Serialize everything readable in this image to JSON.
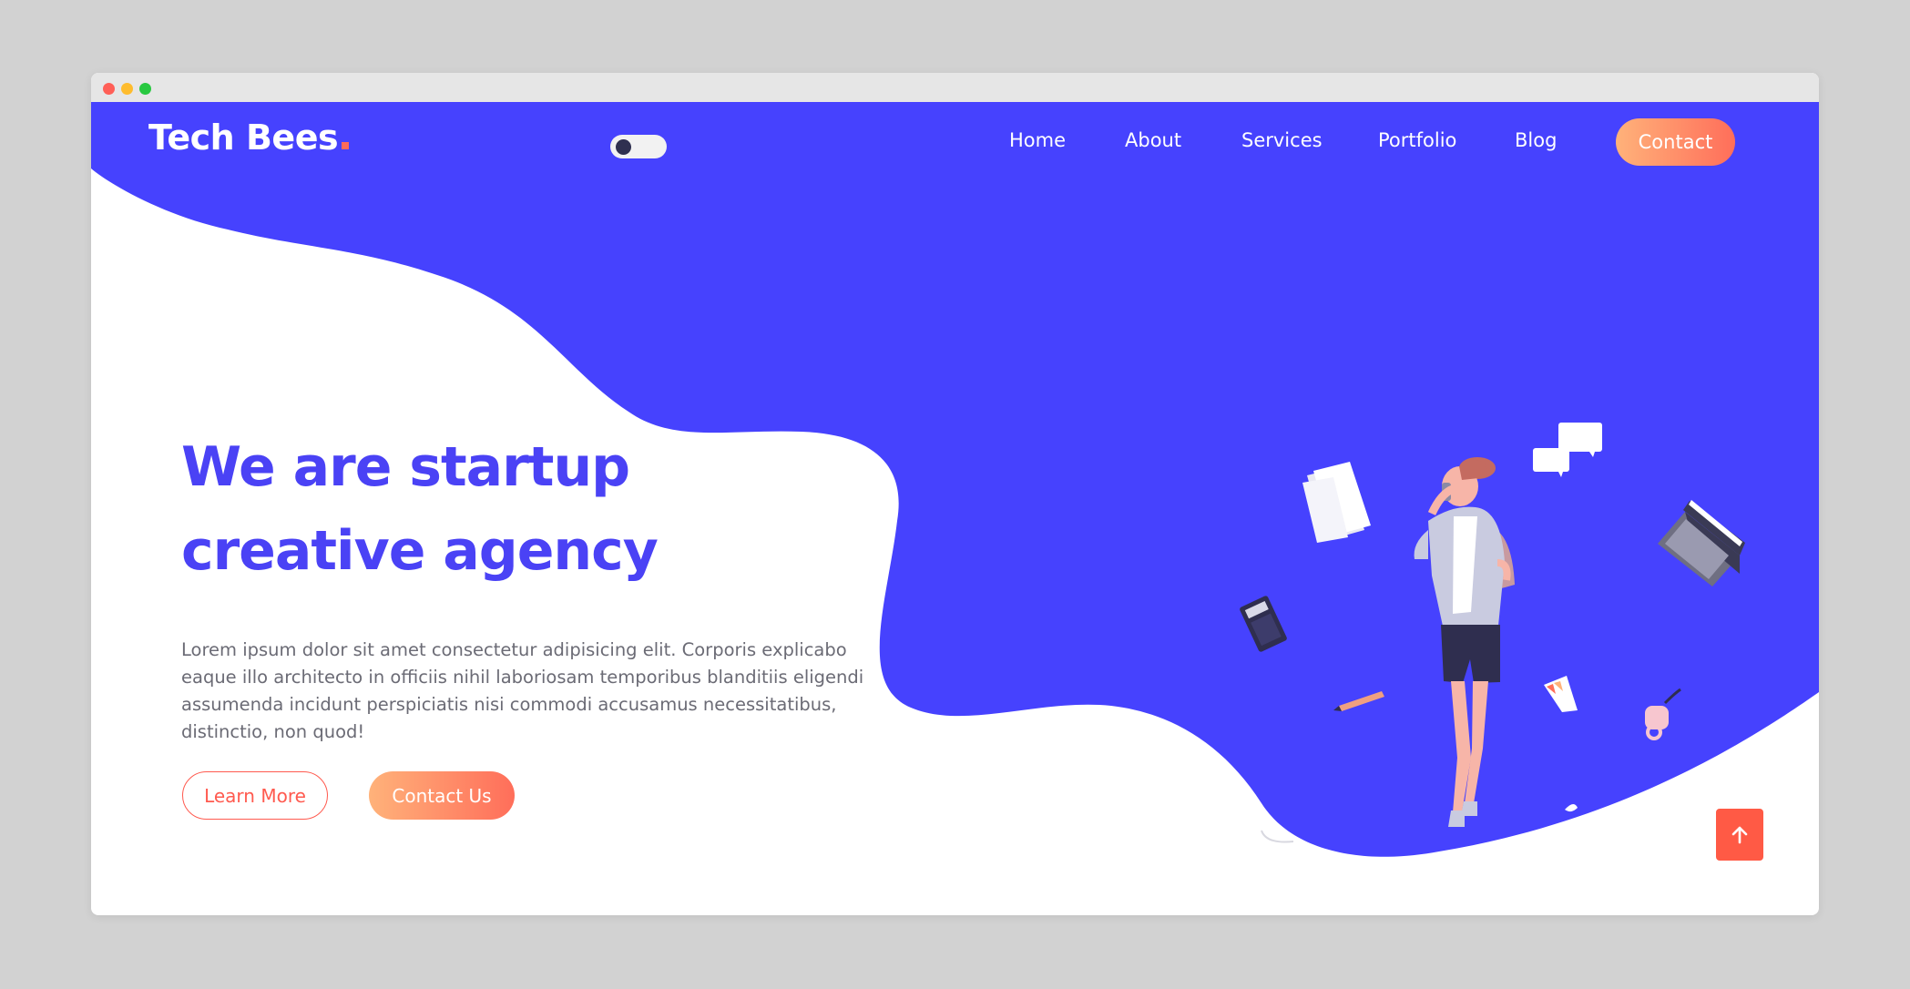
{
  "brand": {
    "name": "Tech Bees"
  },
  "nav": {
    "items": [
      {
        "label": "Home"
      },
      {
        "label": "About"
      },
      {
        "label": "Services"
      },
      {
        "label": "Portfolio"
      },
      {
        "label": "Blog"
      }
    ],
    "contact_label": "Contact"
  },
  "theme_toggle": {
    "state": "off"
  },
  "hero": {
    "title_line1": "We are startup",
    "title_line2": "creative agency",
    "text": "Lorem ipsum dolor sit amet consectetur adipisicing elit. Corporis explicabo eaque illo architecto in officiis nihil laboriosam temporibus blanditiis eligendi assumenda incidunt perspiciatis nisi commodi accusamus necessitatibus, distinctio, non quod!",
    "learn_more_label": "Learn More",
    "contact_us_label": "Contact Us"
  },
  "colors": {
    "primary": "#4a42f5",
    "blob": "#4642fe",
    "accent_gradient_start": "#ffb27a",
    "accent_gradient_end": "#ff6e5a",
    "scroll_top": "#ff5a45"
  },
  "icons": {
    "scroll_top": "arrow-up-icon",
    "illustration": "person-on-phone-illustration"
  }
}
